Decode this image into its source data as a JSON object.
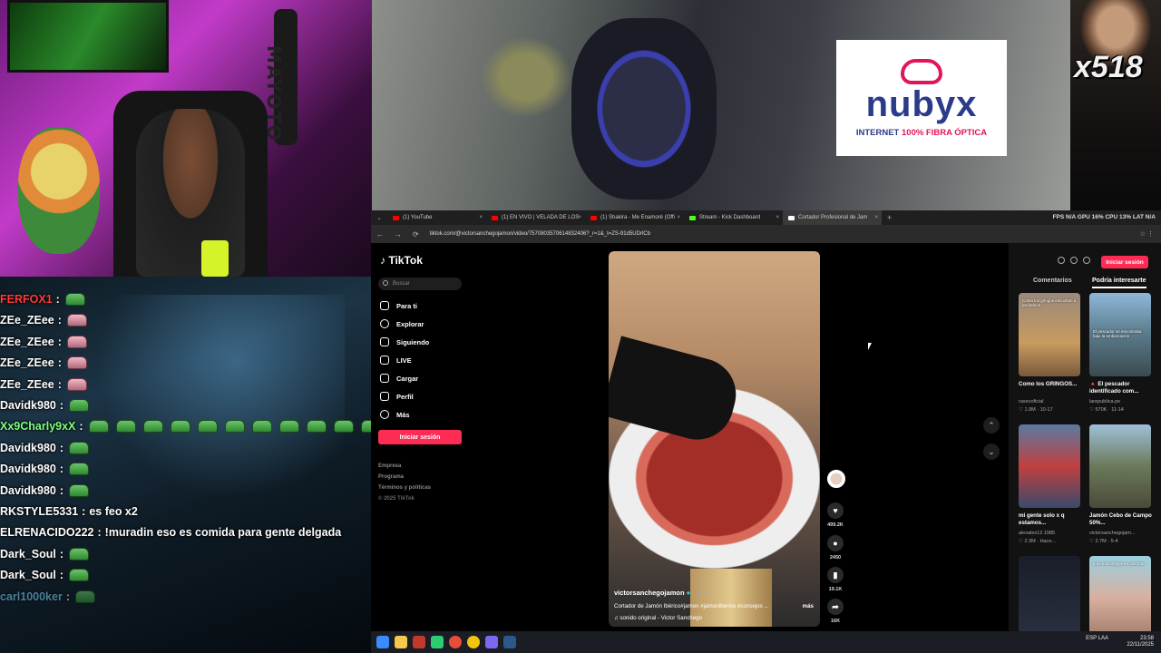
{
  "webcam": {
    "wall_text": "MAYOTO"
  },
  "chat": {
    "messages": [
      {
        "user": "FERFOX1",
        "sep": ":",
        "text": "",
        "emotes": 1,
        "color": "#ff3a3a",
        "pink": false
      },
      {
        "user": "ZEe_ZEee",
        "sep": ":",
        "text": "",
        "emotes": 1,
        "color": "#ffffff",
        "pink": true
      },
      {
        "user": "ZEe_ZEee",
        "sep": ":",
        "text": "",
        "emotes": 1,
        "color": "#ffffff",
        "pink": true
      },
      {
        "user": "ZEe_ZEee",
        "sep": ":",
        "text": "",
        "emotes": 1,
        "color": "#ffffff",
        "pink": true
      },
      {
        "user": "ZEe_ZEee",
        "sep": ":",
        "text": "",
        "emotes": 1,
        "color": "#ffffff",
        "pink": true
      },
      {
        "user": "Davidk980",
        "sep": ":",
        "text": "",
        "emotes": 1,
        "color": "#ffffff",
        "pink": false
      },
      {
        "user": "Xx9Charly9xX",
        "sep": ":",
        "text": "",
        "emotes": 11,
        "color": "#7dff7d",
        "pink": false
      },
      {
        "user": "Davidk980",
        "sep": ":",
        "text": "",
        "emotes": 1,
        "color": "#ffffff",
        "pink": false
      },
      {
        "user": "Davidk980",
        "sep": ":",
        "text": "",
        "emotes": 1,
        "color": "#ffffff",
        "pink": false
      },
      {
        "user": "Davidk980",
        "sep": ":",
        "text": "",
        "emotes": 1,
        "color": "#ffffff",
        "pink": false
      },
      {
        "user": "RKSTYLE5331",
        "sep": ":",
        "text": "es feo x2",
        "emotes": 0,
        "color": "#ffffff",
        "pink": false
      },
      {
        "user": "ELRENACIDO222",
        "sep": ":",
        "text": "!muradin eso es comida para gente delgada",
        "emotes": 0,
        "color": "#ffffff",
        "pink": false
      },
      {
        "user": "Dark_Soul",
        "sep": ":",
        "text": "",
        "emotes": 1,
        "color": "#ffffff",
        "pink": false
      },
      {
        "user": "Dark_Soul",
        "sep": ":",
        "text": "",
        "emotes": 1,
        "color": "#ffffff",
        "pink": false
      },
      {
        "user": "carl1000ker",
        "sep": ":",
        "text": "",
        "emotes": 1,
        "color": "#7dd0ff",
        "pink": false
      }
    ]
  },
  "ad": {
    "brand": "nubyx",
    "tagline_a": "INTERNET ",
    "tagline_b": "100% FIBRA ÓPTICA",
    "tagline_color": "#e0155b"
  },
  "overlay": {
    "counter": "x518"
  },
  "browser": {
    "tabs": [
      {
        "label": "(1) YouTube",
        "color": "#ff0000"
      },
      {
        "label": "(1) EN VIVO | VELADA DE LOS",
        "color": "#ff0000"
      },
      {
        "label": "(1) Shakira - Me Enamoré (Offi",
        "color": "#ff0000"
      },
      {
        "label": "Stream - Kick Dashboard",
        "color": "#53fc18"
      },
      {
        "label": "Cortador Profesional de Jam",
        "color": "#ffffff"
      }
    ],
    "stats": "FPS N/A   GPU 16%   CPU 13%   LAT N/A",
    "url": "tiktok.com/@victorsanchegojamon/video/7570803570614832406?_r=1&_t=ZS-91d5UDrlCb"
  },
  "tiktok": {
    "logo": "TikTok",
    "search_placeholder": "Buscar",
    "nav": [
      "Para ti",
      "Explorar",
      "Siguiendo",
      "LIVE",
      "Cargar",
      "Perfil",
      "Más"
    ],
    "login": "Iniciar sesión",
    "footer": [
      "Empresa",
      "Programa",
      "Términos y políticas",
      "© 2025 TikTok"
    ],
    "video": {
      "author": "victorsanchegojamon",
      "date": "· 11-6",
      "description": "Cortador de Jamón Ibérico#jamon #jamonIberico #consejos ...",
      "more": "más",
      "sound": "♫ sonido original - Victor Sanchego"
    },
    "actions": {
      "likes": "499.2K",
      "comments": "2450",
      "saves": "19.1K",
      "shares": "16K"
    },
    "right": {
      "login": "Iniciar sesión",
      "tabs": [
        "Comentarios",
        "Podría interesarte"
      ],
      "cards": [
        {
          "caption": "Como los GRINGOS...",
          "author": "rasecoficial",
          "stats": "♡ 1.9M · 10-17",
          "overlay": "Como los gringos escuchan a los latinos"
        },
        {
          "caption": "🔺 El pescador identificado com...",
          "author": "larepublica.pe",
          "stats": "♡ 570K · 11-14",
          "overlay": "El pescador se encontraba bajo la embarcación"
        },
        {
          "caption": "mi gente solo x q estamos...",
          "author": "alexalex12.1985",
          "stats": "♡ 2.3M · Hace...",
          "overlay": ""
        },
        {
          "caption": "Jamón Cebo de Campo 50%...",
          "author": "victorsanchegojam...",
          "stats": "♡ 2.7M · 5-4",
          "overlay": ""
        },
        {
          "caption": "",
          "author": "",
          "stats": "",
          "overlay": ""
        },
        {
          "caption": "",
          "author": "",
          "stats": "",
          "overlay": "5 de mis amigos en una foto"
        }
      ]
    }
  },
  "taskbar": {
    "lang": "ESP LAA",
    "time": "23:58",
    "date": "22/11/2025"
  }
}
